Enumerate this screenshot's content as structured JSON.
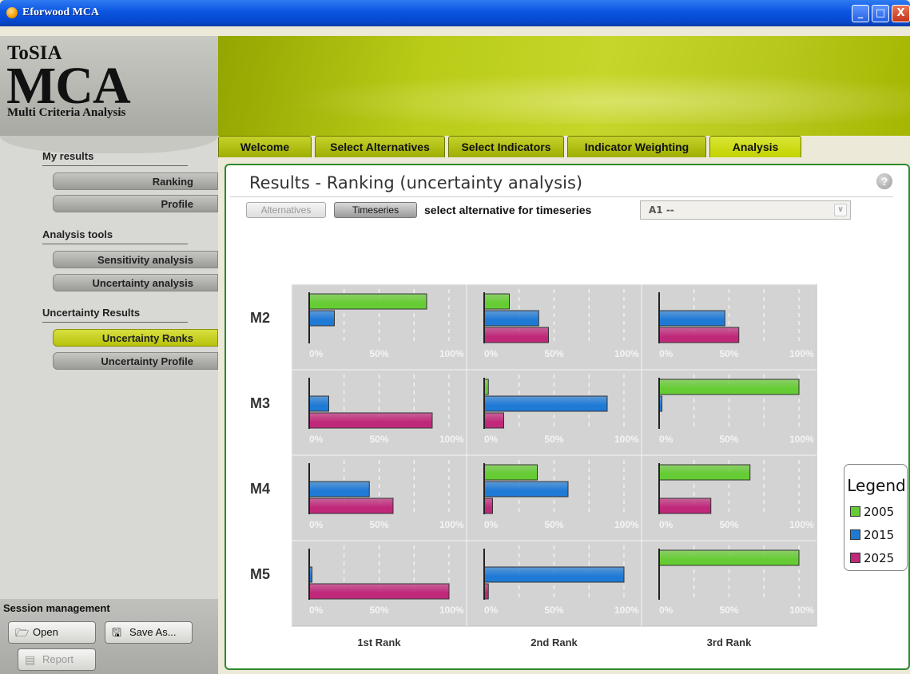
{
  "window": {
    "title": "Eforwood MCA",
    "minimize": "_",
    "maximize": "□",
    "close": "X",
    "app_icon": "circle-icon"
  },
  "logo": {
    "line1": "ToSIA",
    "line2": "MCA",
    "line3": "Multi Criteria Analysis"
  },
  "sidebar": {
    "sections": [
      {
        "label": "My results",
        "items": [
          {
            "label": "Ranking",
            "active": false
          },
          {
            "label": "Profile",
            "active": false
          }
        ]
      },
      {
        "label": "Analysis tools",
        "items": [
          {
            "label": "Sensitivity analysis",
            "active": false
          },
          {
            "label": "Uncertainty analysis",
            "active": false
          }
        ]
      },
      {
        "label": "Uncertainty Results",
        "items": [
          {
            "label": "Uncertainty Ranks",
            "active": true
          },
          {
            "label": "Uncertainty Profile",
            "active": false
          }
        ]
      }
    ]
  },
  "session": {
    "label": "Session management",
    "open": "Open",
    "save_as": "Save As...",
    "report": "Report",
    "open_icon": "folder-open-icon",
    "save_icon": "save-icon",
    "report_icon": "report-icon"
  },
  "tabs": [
    {
      "label": "Welcome",
      "active": false
    },
    {
      "label": "Select Alternatives",
      "active": false
    },
    {
      "label": "Select Indicators",
      "active": false
    },
    {
      "label": "Indicator Weighting",
      "active": false
    },
    {
      "label": "Analysis",
      "active": true
    }
  ],
  "panel": {
    "title": "Results - Ranking (uncertainty analysis)",
    "help": "?",
    "alternatives_button": "Alternatives",
    "timeseries_button": "Timeseries",
    "select_label": "select alternative for timeseries",
    "select_value": "A1 --",
    "select_arrow": "∨"
  },
  "colors": {
    "2005": "#66cc33",
    "2015": "#1f7ad6",
    "2025": "#c0287a"
  },
  "chart_data": {
    "type": "bar",
    "orientation": "horizontal",
    "layout": "small multiples grid",
    "rows": [
      "M2",
      "M3",
      "M4",
      "M5"
    ],
    "columns": [
      "1st Rank",
      "2nd Rank",
      "3rd Rank"
    ],
    "tick_labels": [
      "0%",
      "50%",
      "100%"
    ],
    "xlim": [
      0,
      100
    ],
    "series_names": [
      "2005",
      "2015",
      "2025"
    ],
    "legend": {
      "title": "Legend",
      "placement": "right"
    },
    "values": {
      "M2": {
        "1st Rank": [
          84,
          18,
          0
        ],
        "2nd Rank": [
          18,
          39,
          46
        ],
        "3rd Rank": [
          0,
          47,
          57
        ]
      },
      "M3": {
        "1st Rank": [
          0,
          14,
          88
        ],
        "2nd Rank": [
          3,
          88,
          14
        ],
        "3rd Rank": [
          100,
          2,
          0
        ]
      },
      "M4": {
        "1st Rank": [
          0,
          43,
          60
        ],
        "2nd Rank": [
          38,
          60,
          6
        ],
        "3rd Rank": [
          65,
          0,
          37
        ]
      },
      "M5": {
        "1st Rank": [
          0,
          2,
          100
        ],
        "2nd Rank": [
          0,
          100,
          3
        ],
        "3rd Rank": [
          100,
          0,
          0
        ]
      }
    }
  }
}
